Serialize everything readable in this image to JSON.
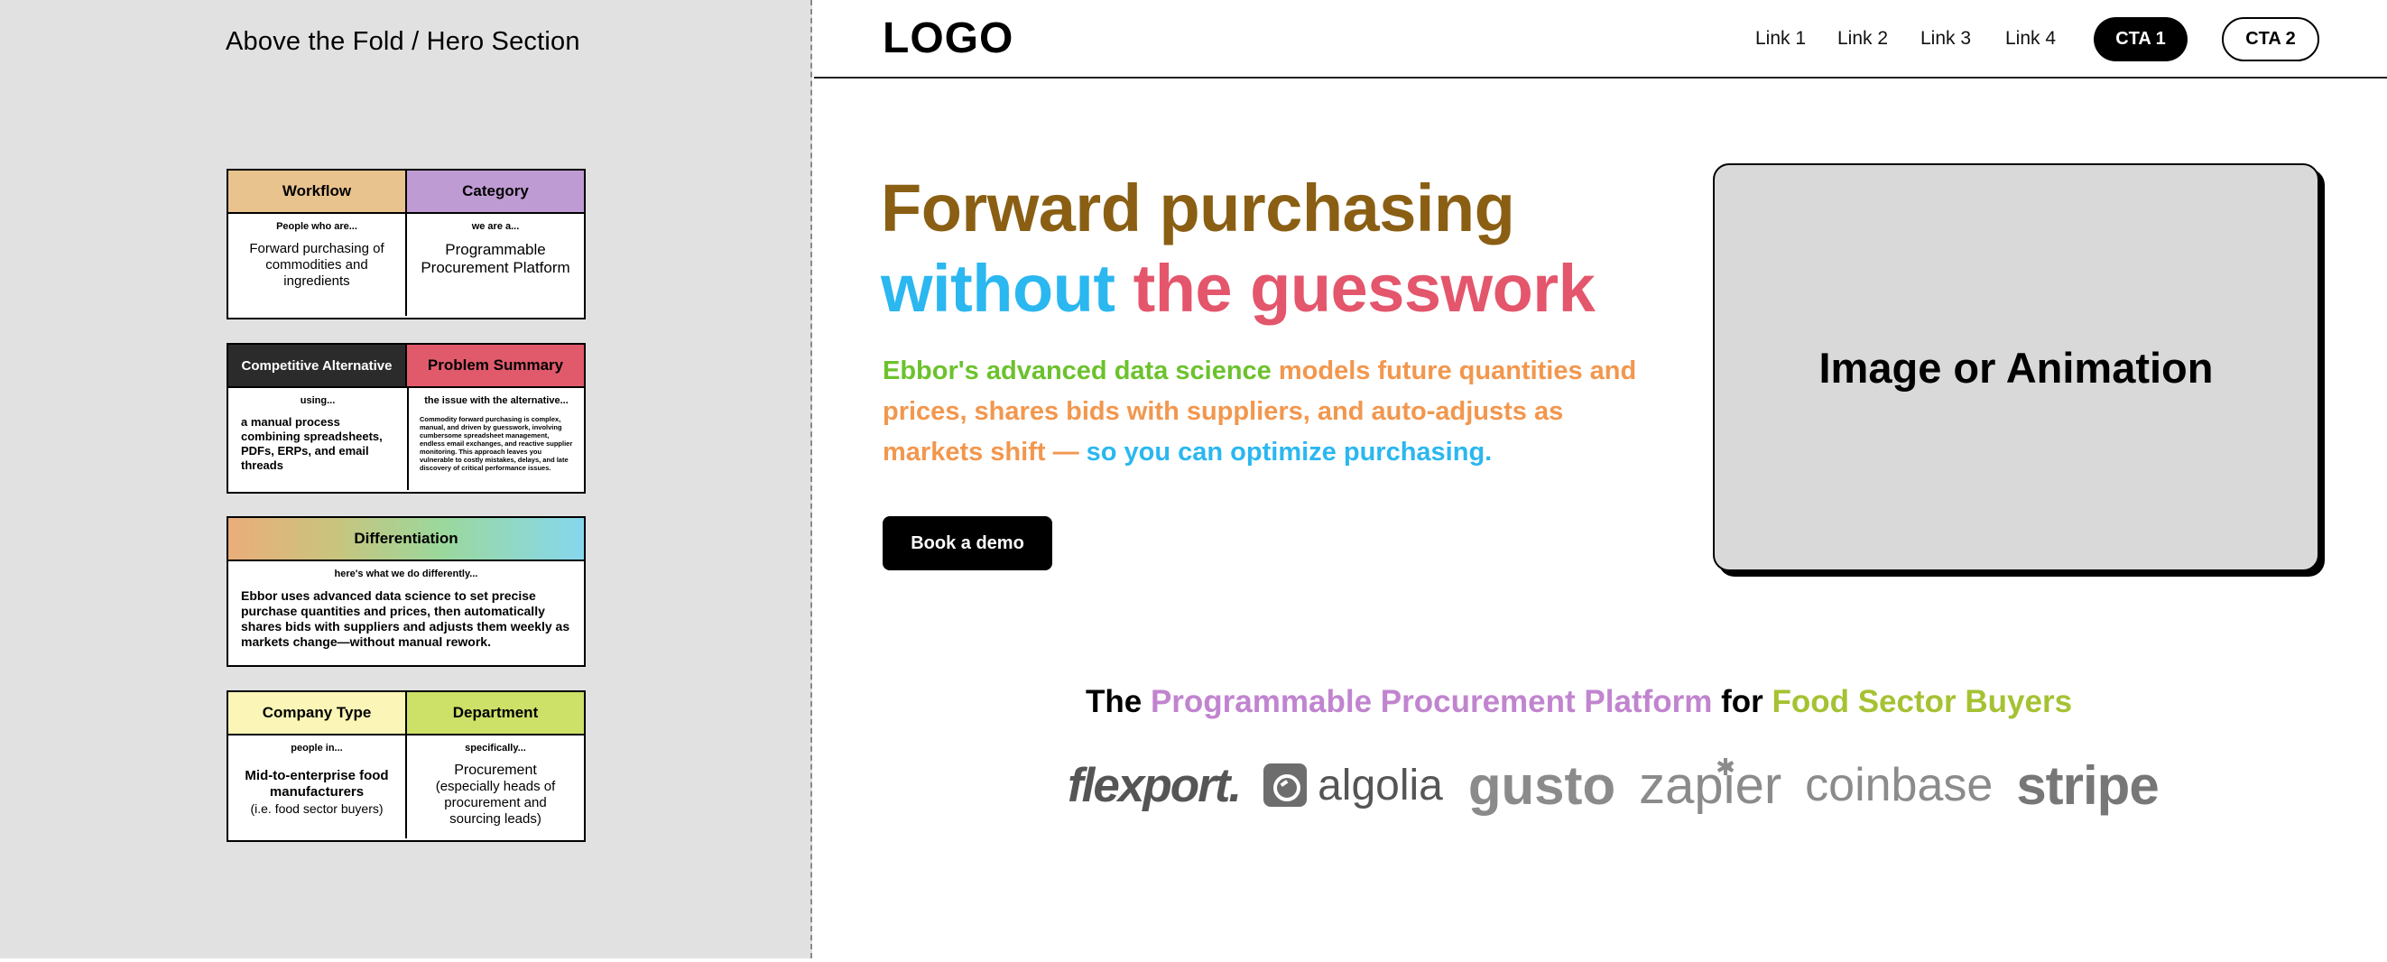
{
  "left_panel": {
    "title": "Above the Fold / Hero Section",
    "grids": [
      {
        "left": {
          "header": "Workflow",
          "header_color": "#e8c38e",
          "small": "People who are...",
          "body": "Forward purchasing of commodities and ingredients"
        },
        "right": {
          "header": "Category",
          "header_color": "#bf9bd3",
          "small": "we are a...",
          "body": "Programmable Procurement Platform"
        }
      },
      {
        "left": {
          "header": "Competitive Alternative",
          "header_color": "#2b2b2b",
          "small": "using...",
          "body": "a manual process combining spreadsheets, PDFs, ERPs, and email threads"
        },
        "right": {
          "header": "Problem Summary",
          "header_color": "#e05a6c",
          "small": "the issue with the alternative...",
          "body": "Commodity forward purchasing is complex, manual, and driven by guesswork, involving cumbersome spreadsheet management, endless email exchanges, and reactive supplier monitoring. This approach leaves you vulnerable to costly mistakes, delays, and late discovery of critical performance issues."
        }
      },
      {
        "full": {
          "header": "Differentiation",
          "small": "here's what we do differently...",
          "body": "Ebbor uses advanced data science to set precise purchase quantities and prices, then automatically shares bids with suppliers and adjusts them weekly as markets change—without manual rework."
        }
      },
      {
        "left": {
          "header": "Company Type",
          "header_color": "#fbf6b7",
          "small": "people in...",
          "body_bold": "Mid-to-enterprise food manufacturers",
          "body_note": "(i.e. food sector buyers)"
        },
        "right": {
          "header": "Department",
          "header_color": "#cde068",
          "small": "specifically...",
          "body_bold": "Procurement",
          "body_note": "(especially heads of procurement and sourcing leads)"
        }
      }
    ]
  },
  "navbar": {
    "logo": "LOGO",
    "links": [
      "Link 1",
      "Link 2",
      "Link 3",
      "Link 4"
    ],
    "cta1": "CTA 1",
    "cta2": "CTA 2"
  },
  "hero": {
    "headline_part1": "Forward purchasing",
    "headline_part2": "without",
    "headline_part3": "the guesswork",
    "sub_part1": "Ebbor's advanced data science",
    "sub_part2": " models future quantities and prices, shares bids with suppliers, and auto-adjusts as markets shift — ",
    "sub_part3": "so you can optimize purchasing.",
    "button": "Book a demo",
    "media_label": "Image or Animation"
  },
  "social_proof": {
    "tag_part1": "The ",
    "tag_part2": "Programmable Procurement Platform",
    "tag_part3": " for ",
    "tag_part4": "Food Sector Buyers",
    "brands": [
      "flexport.",
      "algolia",
      "gusto",
      "zapier",
      "coinbase",
      "stripe"
    ]
  },
  "colors": {
    "headline_brown": "#8a5f14",
    "headline_blue": "#2bb7f0",
    "headline_red": "#e3566c",
    "sub_green": "#6cc22d",
    "sub_orange": "#f2974e",
    "tag_purple": "#c184cf",
    "tag_olive": "#a5c233"
  }
}
